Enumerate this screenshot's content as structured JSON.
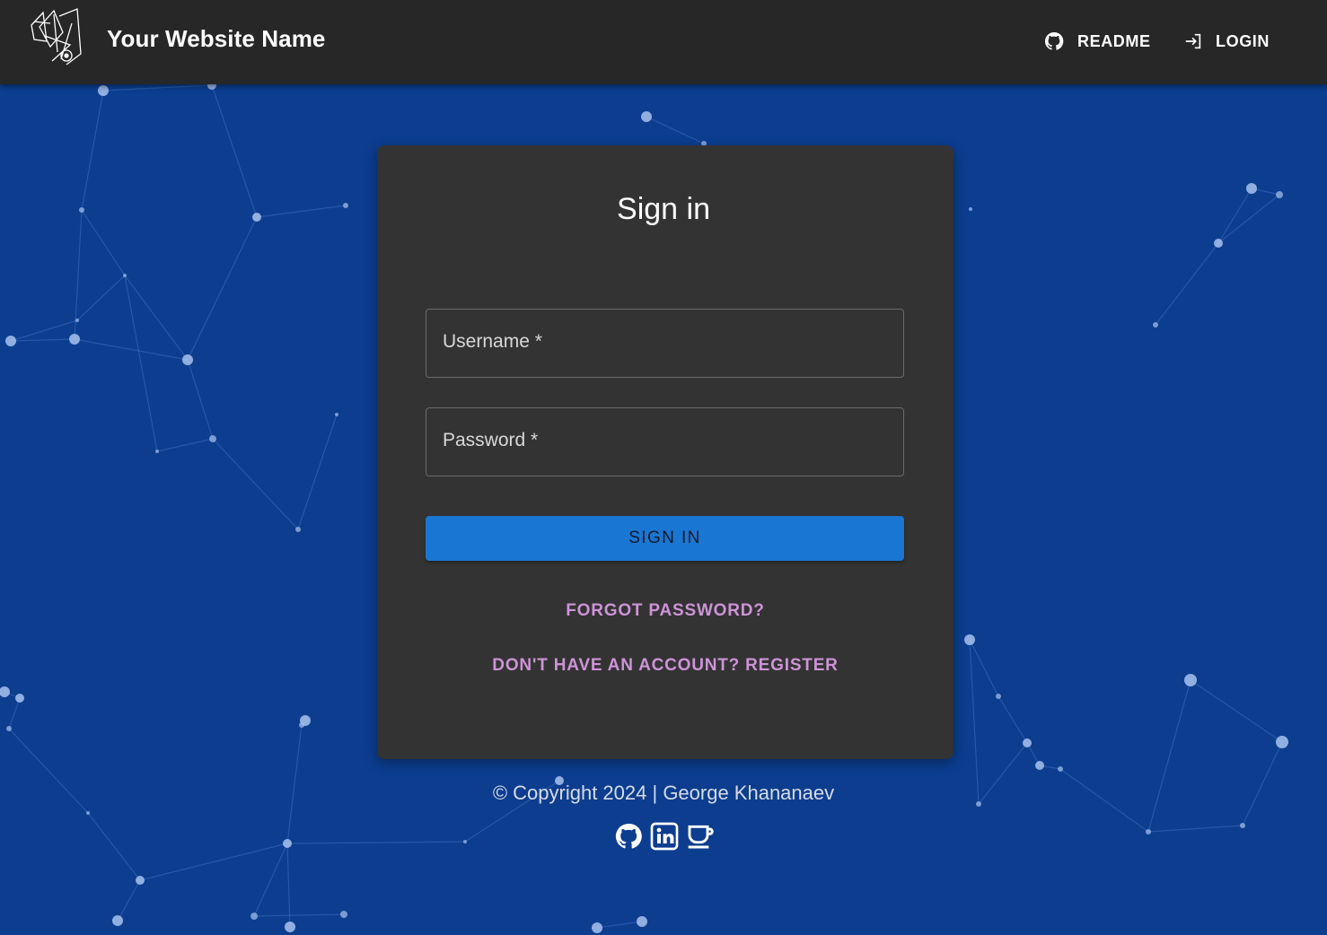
{
  "header": {
    "site_name": "Your Website Name",
    "nav": [
      {
        "label": "README",
        "icon": "github-icon"
      },
      {
        "label": "LOGIN",
        "icon": "login-icon"
      }
    ]
  },
  "signin_card": {
    "title": "Sign in",
    "username_label": "Username *",
    "password_label": "Password *",
    "submit_label": "SIGN IN",
    "forgot_link": "FORGOT PASSWORD?",
    "register_link": "DON'T HAVE AN ACCOUNT? REGISTER"
  },
  "footer": {
    "copyright": "© Copyright 2024 | George Khananaev",
    "social_icons": [
      "github-icon",
      "linkedin-icon",
      "coffee-icon"
    ]
  },
  "colors": {
    "background": "#0c3d8f",
    "appbar": "#272727",
    "card": "#333333",
    "primary_button": "#1976d2",
    "link": "#ce93d8"
  }
}
